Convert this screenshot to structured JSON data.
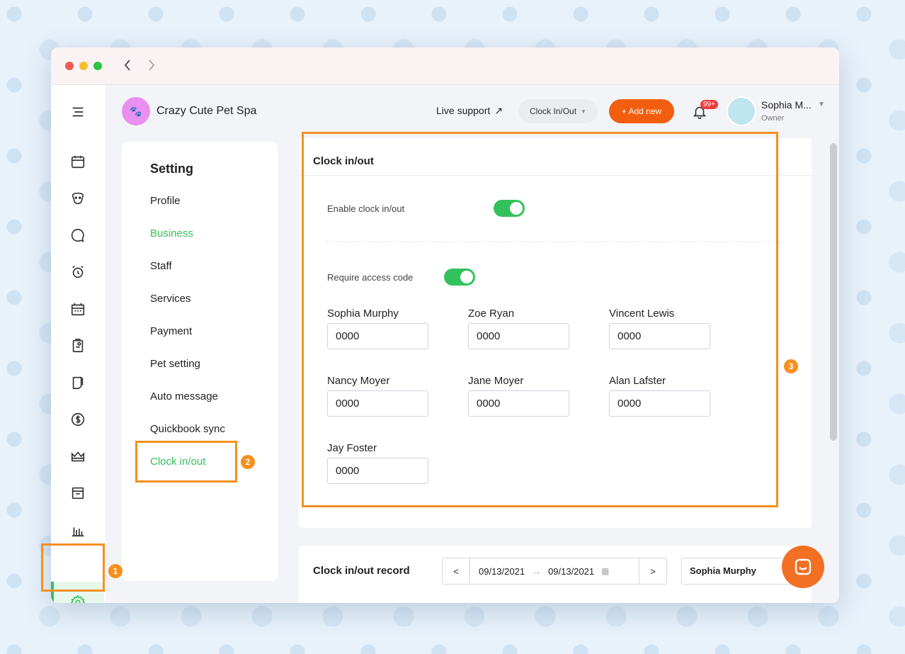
{
  "brand": {
    "name": "Crazy Cute Pet Spa",
    "logo_text": ""
  },
  "header": {
    "live_support": "Live support",
    "clock_button": "Clock In/Out",
    "add_button": "+ Add new",
    "notif_count": "99+",
    "user_name": "Sophia M...",
    "user_role": "Owner"
  },
  "sidebar": {
    "icons": [
      "menu-icon",
      "calendar-icon",
      "pet-icon",
      "chat-icon",
      "alarm-icon",
      "schedule-icon",
      "clipboard-icon",
      "document-icon",
      "dollar-icon",
      "crown-icon",
      "inbox-icon",
      "chart-icon",
      "gear-icon"
    ]
  },
  "settings": {
    "title": "Setting",
    "items": [
      "Profile",
      "Business",
      "Staff",
      "Services",
      "Payment",
      "Pet setting",
      "Auto message",
      "Quickbook sync",
      "Clock in/out"
    ]
  },
  "clock_card": {
    "title": "Clock in/out",
    "enable_label": "Enable clock in/out",
    "require_label": "Require access code",
    "staff": [
      {
        "name": "Sophia Murphy",
        "code": "0000"
      },
      {
        "name": "Zoe Ryan",
        "code": "0000"
      },
      {
        "name": "Vincent Lewis",
        "code": "0000"
      },
      {
        "name": "Nancy Moyer",
        "code": "0000"
      },
      {
        "name": "Jane Moyer",
        "code": "0000"
      },
      {
        "name": "Alan Lafster",
        "code": "0000"
      },
      {
        "name": "Jay Foster",
        "code": "0000"
      }
    ]
  },
  "record_card": {
    "title": "Clock in/out record",
    "prev": "<",
    "next": ">",
    "start_date": "09/13/2021",
    "end_date": "09/13/2021",
    "staff_selected": "Sophia Murphy"
  },
  "steps": [
    "1",
    "2",
    "3"
  ],
  "colors": {
    "accent_green": "#33c15b",
    "brand_orange": "#f25d0e",
    "highlight": "#f5901e"
  }
}
